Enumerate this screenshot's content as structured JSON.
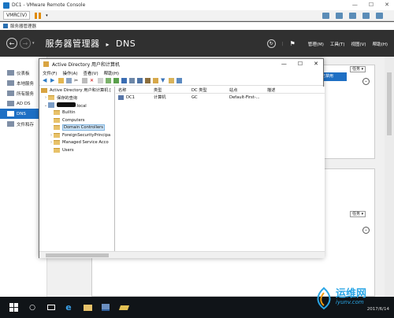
{
  "vm": {
    "title": "DC1 - VMware Remote Console",
    "menu": "VMRC(V)",
    "colors": {
      "pause": "#e08a00"
    }
  },
  "server_manager": {
    "window_title": "服务器管理器",
    "breadcrumb_app": "服务器管理器",
    "breadcrumb_sep": "▸",
    "breadcrumb_page": "DNS",
    "menu": [
      "管理(M)",
      "工具(T)",
      "视图(V)",
      "帮助(H)"
    ],
    "sidebar": [
      {
        "label": "仪表板",
        "active": false
      },
      {
        "label": "本地服务",
        "active": false
      },
      {
        "label": "所有服务",
        "active": false
      },
      {
        "label": "AD DS",
        "active": false
      },
      {
        "label": "DNS",
        "active": true
      },
      {
        "label": "文件和存",
        "active": false
      }
    ],
    "task_label": "任务",
    "selected_row_text": "已禁用"
  },
  "aduc": {
    "title": "Active Directory 用户和计算机",
    "menu": [
      "文件(F)",
      "操作(A)",
      "查看(V)",
      "帮助(H)"
    ],
    "tree": {
      "root": "Active Directory 用户和计算机 [",
      "saved_queries": "保存的查询",
      "domain_suffix": ".local",
      "children": [
        "Builtin",
        "Computers",
        "Domain Controllers",
        "ForeignSecurityPrincipa",
        "Managed Service Acco",
        "Users"
      ],
      "selected": "Domain Controllers"
    },
    "columns": [
      "名称",
      "类型",
      "DC 类型",
      "站点",
      "描述"
    ],
    "rows": [
      {
        "name": "DC1",
        "type": "计算机",
        "dc_type": "GC",
        "site": "Default-First-...",
        "desc": ""
      }
    ]
  },
  "taskbar": {
    "date": "2017/6/14"
  },
  "watermark": {
    "title": "运维网",
    "sub": "iyunv.com"
  }
}
